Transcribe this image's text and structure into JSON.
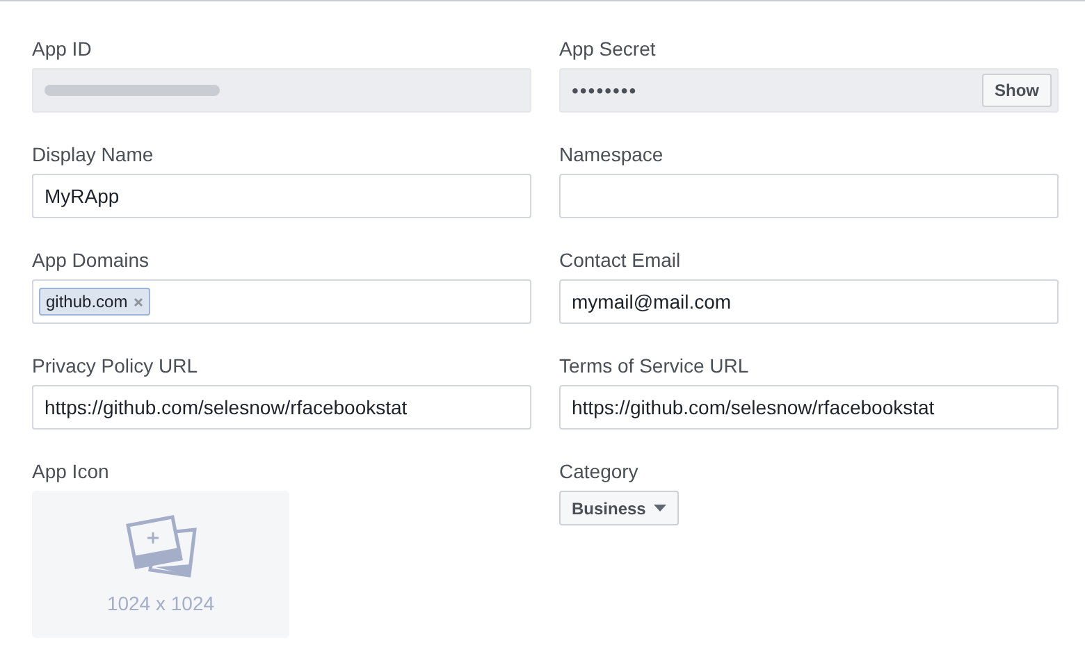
{
  "fields": [
    {
      "label": "App ID",
      "kind": "redacted"
    },
    {
      "label": "App Secret",
      "kind": "secret",
      "value": "••••••••",
      "button": "Show"
    },
    {
      "label": "Display Name",
      "kind": "text",
      "value": "MyRApp"
    },
    {
      "label": "Namespace",
      "kind": "text"
    },
    {
      "label": "App Domains",
      "kind": "tags",
      "tags": [
        "github.com"
      ]
    },
    {
      "label": "Contact Email",
      "kind": "text",
      "value": "mymail@mail.com"
    },
    {
      "label": "Privacy Policy URL",
      "kind": "text",
      "value": "https://github.com/selesnow/rfacebookstat"
    },
    {
      "label": "Terms of Service URL",
      "kind": "text",
      "value": "https://github.com/selesnow/rfacebookstat"
    },
    {
      "label": "App Icon",
      "kind": "image",
      "hint": "1024 x 1024"
    },
    {
      "label": "Category",
      "kind": "dropdown",
      "value": "Business"
    }
  ]
}
